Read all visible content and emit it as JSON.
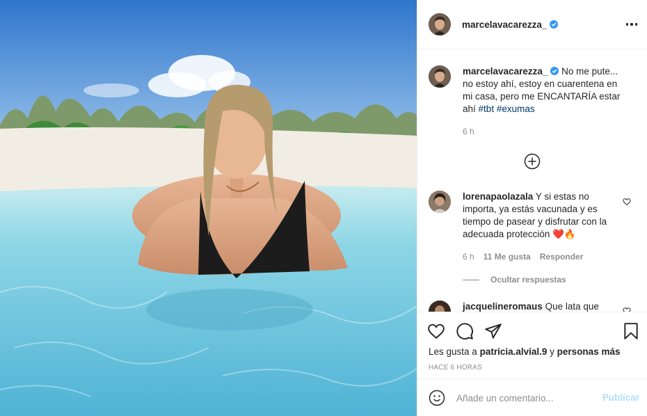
{
  "post": {
    "username": "marcelavacarezza_",
    "caption_body": "No me pute... no estoy ahí, estoy en cuarentena en mi casa, pero me ENCANTARÍA estar ahí",
    "hashtags": [
      "#tbt",
      "#exumas"
    ],
    "caption_time": "6 h"
  },
  "comments": [
    {
      "username": "lorenapaolazala",
      "text": "Y si estas no importa, ya estás vacunada y es tiempo de pasear y disfrutar con la adecuada protección",
      "emojis": "❤️🔥",
      "time": "6 h",
      "likes": "11 Me gusta",
      "reply_label": "Responder"
    },
    {
      "username": "jacquelineromaus",
      "text": "Que lata que"
    }
  ],
  "hide_replies_label": "Ocultar respuestas",
  "likes_summary": {
    "prefix": "Les gusta a",
    "user": "patricia.alvial.9",
    "connector": "y",
    "others": "personas más"
  },
  "timestamp": "HACE 6 HORAS",
  "composer": {
    "placeholder": "Añade un comentario...",
    "publish_label": "Publicar"
  },
  "colors": {
    "verified": "#3897f0",
    "link": "#00376b",
    "publish_disabled": "#b2dffc",
    "muted": "#8e8e8e"
  },
  "icons": [
    "more-options-icon",
    "verified-badge-icon",
    "load-more-icon",
    "heart-icon",
    "comment-icon",
    "share-icon",
    "save-icon",
    "emoji-icon"
  ]
}
